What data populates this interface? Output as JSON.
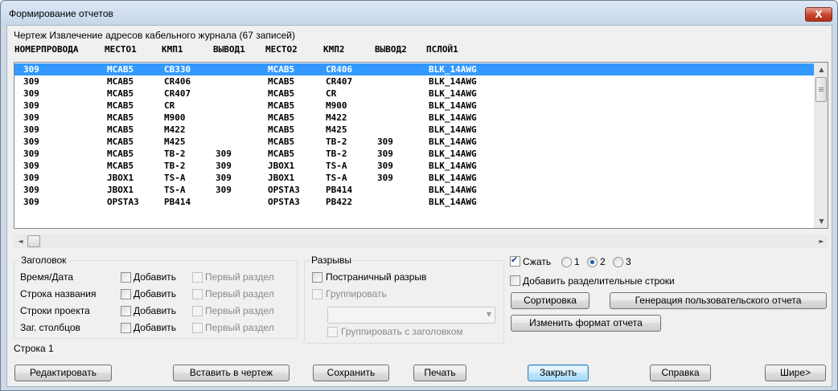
{
  "window": {
    "title": "Формирование отчетов",
    "close_symbol": "X"
  },
  "caption": "Чертеж Извлечение адресов кабельного журнала (67 записей)",
  "columns": [
    "НОМЕРПРОВОДА",
    "МЕСТО1",
    "КМП1",
    "ВЫВОД1",
    "МЕСТО2",
    "КМП2",
    "ВЫВОД2",
    "ПСЛОЙ1"
  ],
  "rows": [
    [
      "309",
      "MCAB5",
      "CB330",
      "",
      "MCAB5",
      "CR406",
      "",
      "BLK_14AWG"
    ],
    [
      "309",
      "MCAB5",
      "CR406",
      "",
      "MCAB5",
      "CR407",
      "",
      "BLK_14AWG"
    ],
    [
      "309",
      "MCAB5",
      "CR407",
      "",
      "MCAB5",
      "CR",
      "",
      "BLK_14AWG"
    ],
    [
      "309",
      "MCAB5",
      "CR",
      "",
      "MCAB5",
      "M900",
      "",
      "BLK_14AWG"
    ],
    [
      "309",
      "MCAB5",
      "M900",
      "",
      "MCAB5",
      "M422",
      "",
      "BLK_14AWG"
    ],
    [
      "309",
      "MCAB5",
      "M422",
      "",
      "MCAB5",
      "M425",
      "",
      "BLK_14AWG"
    ],
    [
      "309",
      "MCAB5",
      "M425",
      "",
      "MCAB5",
      "TB-2",
      "309",
      "BLK_14AWG"
    ],
    [
      "309",
      "MCAB5",
      "TB-2",
      "309",
      "MCAB5",
      "TB-2",
      "309",
      "BLK_14AWG"
    ],
    [
      "309",
      "MCAB5",
      "TB-2",
      "309",
      "JBOX1",
      "TS-A",
      "309",
      "BLK_14AWG"
    ],
    [
      "309",
      "JBOX1",
      "TS-A",
      "309",
      "JBOX1",
      "TS-A",
      "309",
      "BLK_14AWG"
    ],
    [
      "309",
      "JBOX1",
      "TS-A",
      "309",
      "OPSTA3",
      "PB414",
      "",
      "BLK_14AWG"
    ],
    [
      "309",
      "OPSTA3",
      "PB414",
      "",
      "OPSTA3",
      "PB422",
      "",
      "BLK_14AWG"
    ]
  ],
  "selected_row": 0,
  "header_group": {
    "legend": "Заголовок",
    "items": [
      {
        "label": "Время/Дата",
        "add": "Добавить",
        "first": "Первый раздел"
      },
      {
        "label": "Строка названия",
        "add": "Добавить",
        "first": "Первый раздел"
      },
      {
        "label": "Строки проекта",
        "add": "Добавить",
        "first": "Первый раздел"
      },
      {
        "label": "Заг. столбцов",
        "add": "Добавить",
        "first": "Первый раздел"
      }
    ]
  },
  "breaks_group": {
    "legend": "Разрывы",
    "page_break": "Постраничный разрыв",
    "group": "Группировать",
    "group_combo_value": "",
    "group_with_header": "Группировать с заголовком"
  },
  "options": {
    "compress": "Сжать",
    "compress_checked": true,
    "radio_options": [
      "1",
      "2",
      "3"
    ],
    "radio_selected": "2",
    "add_separator": "Добавить разделительные строки"
  },
  "buttons": {
    "sort": "Сортировка",
    "generate_custom": "Генерация пользовательского отчета",
    "change_format": "Изменить формат отчета",
    "edit": "Редактировать",
    "insert": "Вставить в чертеж",
    "save": "Сохранить",
    "print": "Печать",
    "close": "Закрыть",
    "help": "Справка",
    "wider": "Шире>"
  },
  "status": "Строка 1",
  "icons": {
    "scroll_up": "▲",
    "scroll_down": "▼",
    "scroll_left": "◄",
    "scroll_right": "►",
    "combo_arrow": "▼",
    "check": "✔"
  },
  "colors": {
    "selection": "#3399ff",
    "close_button": "#c4432d"
  }
}
